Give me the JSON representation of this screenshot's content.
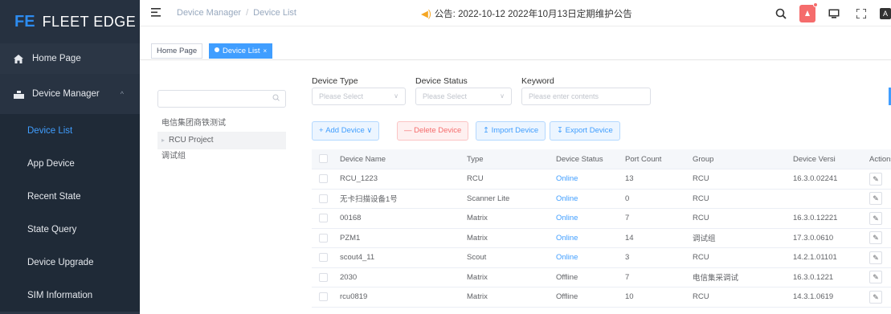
{
  "brand": {
    "logo_glyph": "FE",
    "name": "FLEET EDGE"
  },
  "sidebar": {
    "home": {
      "label": "Home Page",
      "icon": "home-icon"
    },
    "group": {
      "label": "Device Manager",
      "icon": "device-manager-icon"
    },
    "items": [
      {
        "label": "Device List",
        "active": true
      },
      {
        "label": "App Device"
      },
      {
        "label": "Recent State"
      },
      {
        "label": "State Query"
      },
      {
        "label": "Device Upgrade"
      },
      {
        "label": "SIM Information"
      }
    ]
  },
  "topbar": {
    "breadcrumb": [
      "Device Manager",
      "Device List"
    ],
    "notice_label": "公告:",
    "notice_text": "2022-10-12 2022年10月13日定期维护公告",
    "lang_glyph": "A"
  },
  "tags": [
    {
      "label": "Home Page"
    },
    {
      "label": "Device List",
      "active": true
    }
  ],
  "tree": {
    "search_placeholder": "",
    "nodes": [
      "电信集团商铁测试",
      "RCU Project",
      "调试组"
    ]
  },
  "filters": {
    "device_type": {
      "label": "Device Type",
      "placeholder": "Please Select"
    },
    "device_status": {
      "label": "Device Status",
      "placeholder": "Please Select"
    },
    "keyword": {
      "label": "Keyword",
      "placeholder": "Please enter contents"
    }
  },
  "actions": {
    "add": "Add Device",
    "delete": "Delete Device",
    "import": "Import Device",
    "export": "Export Device"
  },
  "table": {
    "headers": [
      "Device Name",
      "Type",
      "Device Status",
      "Port Count",
      "Group",
      "Device Versi",
      "Actions"
    ],
    "rows": [
      {
        "name": "RCU_1223",
        "type": "RCU",
        "status": "Online",
        "ports": "13",
        "group": "RCU",
        "version": "16.3.0.02241"
      },
      {
        "name": "无卡扫描设备1号",
        "type": "Scanner Lite",
        "status": "Online",
        "ports": "0",
        "group": "RCU",
        "version": ""
      },
      {
        "name": "00168",
        "type": "Matrix",
        "status": "Online",
        "ports": "7",
        "group": "RCU",
        "version": "16.3.0.12221"
      },
      {
        "name": "PZM1",
        "type": "Matrix",
        "status": "Online",
        "ports": "14",
        "group": "调试组",
        "version": "17.3.0.0610"
      },
      {
        "name": "scout4_11",
        "type": "Scout",
        "status": "Online",
        "ports": "3",
        "group": "RCU",
        "version": "14.2.1.01101"
      },
      {
        "name": "2030",
        "type": "Matrix",
        "status": "Offline",
        "ports": "7",
        "group": "电信集采调试",
        "version": "16.3.0.1221"
      },
      {
        "name": "rcu0819",
        "type": "Matrix",
        "status": "Offline",
        "ports": "10",
        "group": "RCU",
        "version": "14.3.1.0619"
      }
    ]
  },
  "colors": {
    "sidebar_bg": "#2b3645",
    "accent": "#409eff",
    "danger": "#f56c6c",
    "online": "#409eff"
  }
}
